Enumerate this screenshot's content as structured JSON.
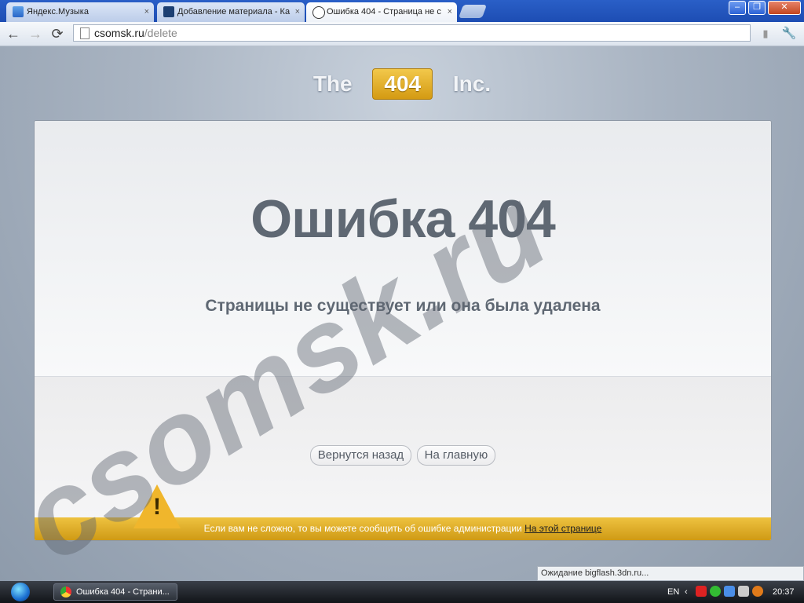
{
  "tabs": [
    {
      "title": "Яндекс.Музыка",
      "close": "×"
    },
    {
      "title": "Добавление материала - Ка",
      "close": "×"
    },
    {
      "title": "Ошибка 404 - Страница не с",
      "close": "×"
    }
  ],
  "window_controls": {
    "minimize": "–",
    "maximize": "❐",
    "close": "✕"
  },
  "toolbar": {
    "back": "←",
    "forward": "→",
    "reload": "⟳",
    "wrench": "🔧"
  },
  "address": {
    "host": "csomsk.ru",
    "path": "/delete"
  },
  "brand": {
    "left": "The",
    "badge": "404",
    "right": "Inc."
  },
  "error": {
    "title": "Ошибка 404",
    "subtitle": "Страницы не существует или она была удалена",
    "back_button": "Вернутся назад",
    "home_button": "На главную",
    "footer_text": "Если вам не сложно, то вы можете сообщить об ошибке администрации",
    "footer_link": "На этой странице",
    "warning_mark": "!"
  },
  "watermark": "csomsk.ru",
  "status": "Ожидание bigflash.3dn.ru...",
  "taskbar": {
    "window_title": "Ошибка 404 - Страни...",
    "language": "EN",
    "clock": "20:37"
  },
  "colors": {
    "accent": "#d9a01a",
    "title_text": "#5f6873",
    "titlebar": "#1d4db3"
  }
}
